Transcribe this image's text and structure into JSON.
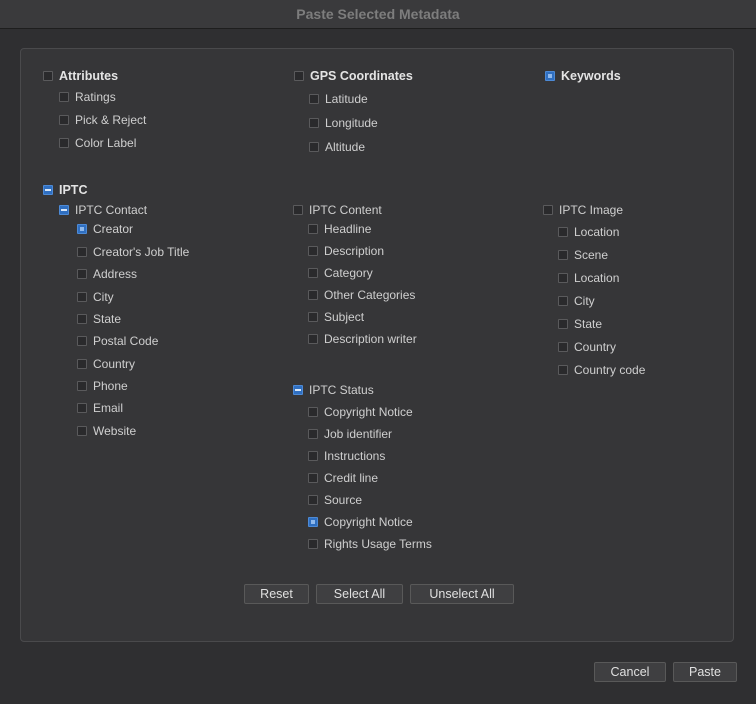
{
  "window": {
    "title": "Paste Selected Metadata"
  },
  "attributes": {
    "label": "Attributes",
    "state": "unchecked",
    "items": [
      {
        "label": "Ratings",
        "state": "unchecked"
      },
      {
        "label": "Pick & Reject",
        "state": "unchecked"
      },
      {
        "label": "Color Label",
        "state": "unchecked"
      }
    ]
  },
  "gps": {
    "label": "GPS Coordinates",
    "state": "unchecked",
    "items": [
      {
        "label": "Latitude",
        "state": "unchecked"
      },
      {
        "label": "Longitude",
        "state": "unchecked"
      },
      {
        "label": "Altitude",
        "state": "unchecked"
      }
    ]
  },
  "keywords": {
    "label": "Keywords",
    "state": "checked"
  },
  "iptc": {
    "label": "IPTC",
    "state": "mixed",
    "contact": {
      "label": "IPTC Contact",
      "state": "mixed",
      "items": [
        {
          "label": "Creator",
          "state": "checked"
        },
        {
          "label": "Creator's Job Title",
          "state": "unchecked"
        },
        {
          "label": "Address",
          "state": "unchecked"
        },
        {
          "label": "City",
          "state": "unchecked"
        },
        {
          "label": "State",
          "state": "unchecked"
        },
        {
          "label": "Postal Code",
          "state": "unchecked"
        },
        {
          "label": "Country",
          "state": "unchecked"
        },
        {
          "label": "Phone",
          "state": "unchecked"
        },
        {
          "label": "Email",
          "state": "unchecked"
        },
        {
          "label": "Website",
          "state": "unchecked"
        }
      ]
    },
    "content": {
      "label": "IPTC Content",
      "state": "unchecked",
      "items": [
        {
          "label": "Headline",
          "state": "unchecked"
        },
        {
          "label": "Description",
          "state": "unchecked"
        },
        {
          "label": "Category",
          "state": "unchecked"
        },
        {
          "label": "Other Categories",
          "state": "unchecked"
        },
        {
          "label": "Subject",
          "state": "unchecked"
        },
        {
          "label": "Description writer",
          "state": "unchecked"
        }
      ]
    },
    "status": {
      "label": "IPTC Status",
      "state": "mixed",
      "items": [
        {
          "label": "Copyright Notice",
          "state": "unchecked"
        },
        {
          "label": "Job identifier",
          "state": "unchecked"
        },
        {
          "label": "Instructions",
          "state": "unchecked"
        },
        {
          "label": "Credit line",
          "state": "unchecked"
        },
        {
          "label": "Source",
          "state": "unchecked"
        },
        {
          "label": "Copyright Notice",
          "state": "checked"
        },
        {
          "label": "Rights Usage Terms",
          "state": "unchecked"
        }
      ]
    },
    "image": {
      "label": "IPTC Image",
      "state": "unchecked",
      "items": [
        {
          "label": "Location",
          "state": "unchecked"
        },
        {
          "label": "Scene",
          "state": "unchecked"
        },
        {
          "label": "Location",
          "state": "unchecked"
        },
        {
          "label": "City",
          "state": "unchecked"
        },
        {
          "label": "State",
          "state": "unchecked"
        },
        {
          "label": "Country",
          "state": "unchecked"
        },
        {
          "label": "Country code",
          "state": "unchecked"
        }
      ]
    }
  },
  "buttons": {
    "reset": "Reset",
    "select_all": "Select All",
    "unselect_all": "Unselect All",
    "cancel": "Cancel",
    "paste": "Paste"
  },
  "colors": {
    "accent": "#2f6fc1",
    "background": "#2f2f31",
    "panel": "#363638"
  }
}
